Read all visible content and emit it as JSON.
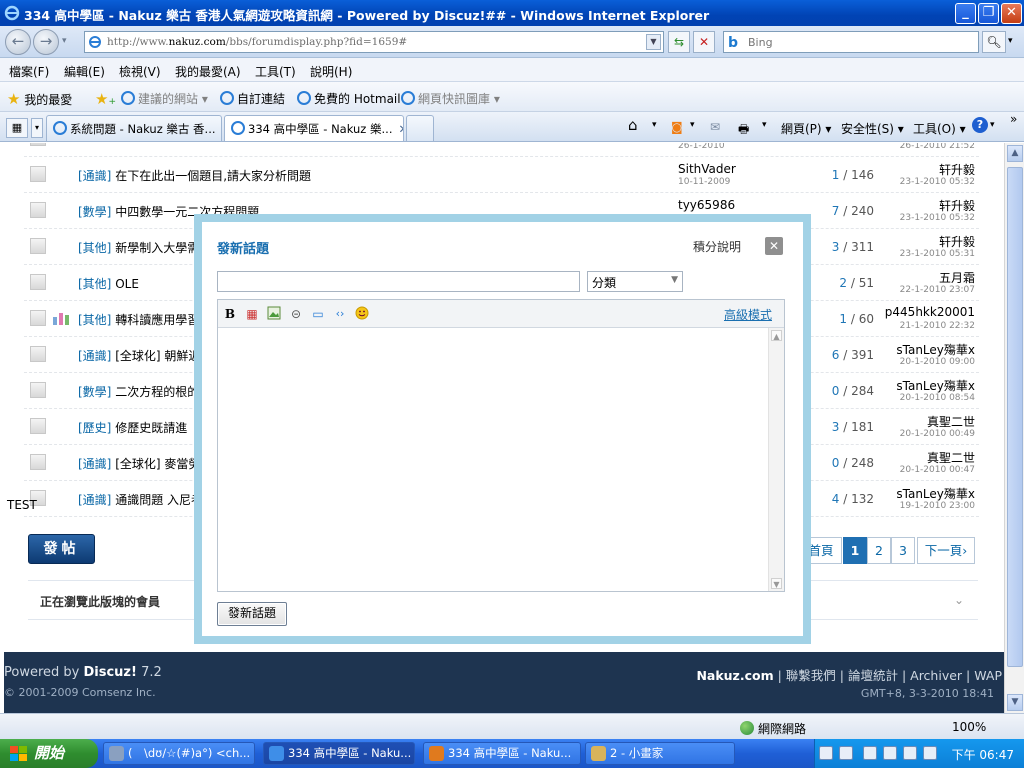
{
  "window": {
    "title": "334 高中學區 - Nakuz 樂古 香港人氣網遊攻略資訊網 - Powered by Discuz!## - Windows Internet Explorer"
  },
  "address": {
    "url_prefix": "http://www.",
    "url_domain": "nakuz.com",
    "url_rest": "/bbs/forumdisplay.php?fid=1659#",
    "search_placeholder": "Bing",
    "search_engine": "b"
  },
  "menu": [
    "檔案(F)",
    "編輯(E)",
    "檢視(V)",
    "我的最愛(A)",
    "工具(T)",
    "說明(H)"
  ],
  "favorites": {
    "main": "我的最愛",
    "items": [
      "建議的網站 ▾",
      "自訂連結",
      "免費的 Hotmail",
      "網頁快訊圖庫 ▾"
    ]
  },
  "tabs": {
    "items": [
      "系統問題 - Nakuz 樂古 香...",
      "334 高中學區 - Nakuz 樂..."
    ],
    "close": "✕",
    "commands": [
      "網頁(P) ▾",
      "安全性(S) ▾",
      "工具(O) ▾"
    ],
    "more": "»"
  },
  "threads": [
    {
      "cat": "[通識]",
      "title": "在下在此出一個題目,請大家分析問題",
      "author": "SithVader",
      "author_date": "10-11-2009",
      "replies": "1",
      "views": "146",
      "last": "轩升毅",
      "last_date": "23-1-2010 05:32",
      "poll": false
    },
    {
      "cat": "[數學]",
      "title": "中四數學一元二次方程問題",
      "author": "tyy65986",
      "author_date": "",
      "replies": "7",
      "views": "240",
      "last": "轩升毅",
      "last_date": "23-1-2010 05:32",
      "poll": false
    },
    {
      "cat": "[其他]",
      "title": "新學制入大學需",
      "author": "",
      "author_date": "",
      "replies": "3",
      "views": "311",
      "last": "轩升毅",
      "last_date": "23-1-2010 05:31",
      "poll": false
    },
    {
      "cat": "[其他]",
      "title": "OLE",
      "author": "",
      "author_date": "",
      "replies": "2",
      "views": "51",
      "last": "五月霜",
      "last_date": "22-1-2010 23:07",
      "poll": false
    },
    {
      "cat": "[其他]",
      "title": "轉科讀應用學習",
      "author": "",
      "author_date": "",
      "replies": "1",
      "views": "60",
      "last": "p445hkk20001",
      "last_date": "21-1-2010 22:32",
      "poll": true
    },
    {
      "cat": "[通識]",
      "title": "[全球化] 朝鮮近",
      "author": "",
      "author_date": "",
      "replies": "6",
      "views": "391",
      "last": "sTanLey殤華x",
      "last_date": "20-1-2010 09:00",
      "poll": false
    },
    {
      "cat": "[數學]",
      "title": "二次方程的根的",
      "author": "",
      "author_date": "",
      "replies": "0",
      "views": "284",
      "last": "sTanLey殤華x",
      "last_date": "20-1-2010 08:54",
      "poll": false
    },
    {
      "cat": "[歷史]",
      "title": "修歷史既請進",
      "author": "",
      "author_date": "",
      "replies": "3",
      "views": "181",
      "last": "真聖二世",
      "last_date": "20-1-2010 00:49",
      "poll": false
    },
    {
      "cat": "[通識]",
      "title": "[全球化] 麥當勞",
      "author": "",
      "author_date": "",
      "replies": "0",
      "views": "248",
      "last": "真聖二世",
      "last_date": "20-1-2010 00:47",
      "poll": false
    },
    {
      "cat": "[通識]",
      "title": "通識問題 入尼者",
      "author": "",
      "author_date": "",
      "replies": "4",
      "views": "132",
      "last": "sTanLey殤華x",
      "last_date": "19-1-2010 23:00",
      "poll": false
    }
  ],
  "partial_top": {
    "author_date": "26-1-2010",
    "last_date": "26-1-2010 21:52"
  },
  "test_label": "TEST",
  "post_button": "發帖",
  "pager": {
    "first": "首頁",
    "pages": [
      "1",
      "2",
      "3"
    ],
    "current": "1",
    "next": "下一頁›"
  },
  "browsing": {
    "label": "正在瀏覽此版塊的會員",
    "chevron": "⌄"
  },
  "footer": {
    "powered_prefix": "Powered by ",
    "powered_brand": "Discuz!",
    "powered_version": " 7.2",
    "copyright": "© 2001-2009 Comsenz Inc.",
    "brand": "Nakuz.com",
    "links": [
      "聯繫我們",
      "論壇統計",
      "Archiver",
      "WAP"
    ],
    "time": "GMT+8, 3-3-2010 18:41"
  },
  "modal": {
    "title": "發新話題",
    "help": "積分說明",
    "close": "✕",
    "subject_value": "",
    "category": "分類",
    "advanced": "高級模式",
    "toolbar_bold": "B",
    "submit": "發新話題"
  },
  "status": {
    "zone": "網際網路",
    "zoom": "100%"
  },
  "taskbar": {
    "start": "開始",
    "tasks": [
      {
        "label": "(　\\dʊ/☆(#)a°) <ch...",
        "color": "#8aa0c0"
      },
      {
        "label": "334 高中學區 - Naku...",
        "color": "#3e8ee8"
      },
      {
        "label": "334 高中學區 - Naku...",
        "color": "#e07a1e"
      },
      {
        "label": "2 - 小畫家",
        "color": "#d9b35a"
      }
    ],
    "clock": "下午 06:47"
  }
}
